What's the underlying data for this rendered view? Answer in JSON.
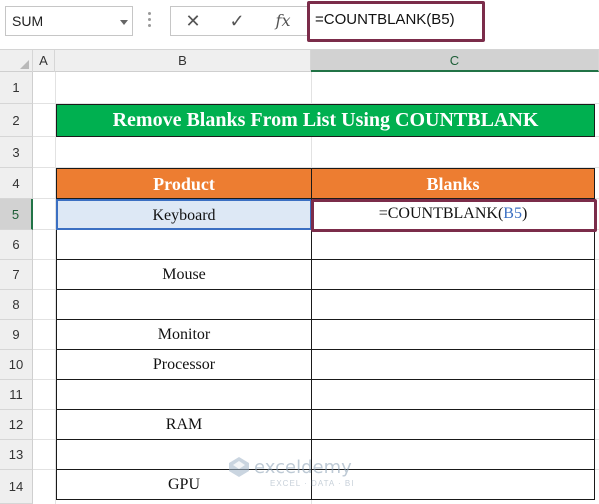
{
  "formula_bar": {
    "name_box": "SUM",
    "cancel_icon": "✕",
    "enter_icon": "✓",
    "fx_label": "fx",
    "formula": "=COUNTBLANK(B5)"
  },
  "columns": [
    "A",
    "B",
    "C"
  ],
  "rows": [
    "1",
    "2",
    "3",
    "4",
    "5",
    "6",
    "7",
    "8",
    "9",
    "10",
    "11",
    "12",
    "13",
    "14"
  ],
  "active_row": "5",
  "title": "Remove Blanks From List Using COUNTBLANK",
  "table": {
    "headers": [
      "Product",
      "Blanks"
    ],
    "products": [
      "Keyboard",
      "",
      "Mouse",
      "",
      "Monitor",
      "Processor",
      "",
      "RAM",
      "",
      "GPU"
    ],
    "c5_formula_prefix": "=COUNTBLANK(",
    "c5_formula_ref": "B5",
    "c5_formula_suffix": ")"
  },
  "watermark": {
    "name": "exceldemy",
    "tagline": "EXCEL · DATA · BI"
  },
  "colors": {
    "title_bg": "#00b050",
    "header_bg": "#ed7d31",
    "highlight_border": "#7b2c4a",
    "selection_blue": "#3b6fc2"
  }
}
